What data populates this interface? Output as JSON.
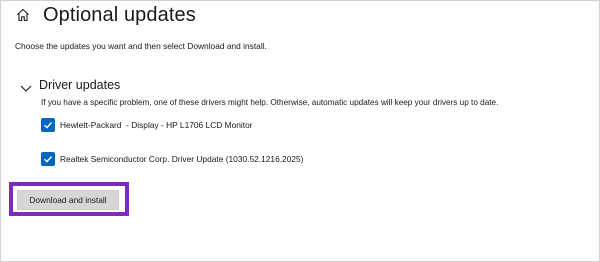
{
  "header": {
    "title": "Optional updates",
    "home_icon": "home-icon"
  },
  "subtitle": "Choose the updates you want and then select Download and install.",
  "section": {
    "title": "Driver updates",
    "expand_icon": "chevron-down-icon",
    "description": "If you have a specific problem, one of these drivers might help. Otherwise, automatic updates will keep your drivers up to date."
  },
  "drivers": [
    {
      "label": "Hewlett-Packard  - Display - HP L1706 LCD Monitor",
      "checked": true
    },
    {
      "label": "Realtek Semiconductor Corp. Driver Update (1030.52.1216.2025)",
      "checked": true
    }
  ],
  "actions": {
    "download_label": "Download and install"
  },
  "colors": {
    "accent": "#0067c0",
    "highlight": "#7b2bbf",
    "button_bg": "#d6d6d6"
  }
}
